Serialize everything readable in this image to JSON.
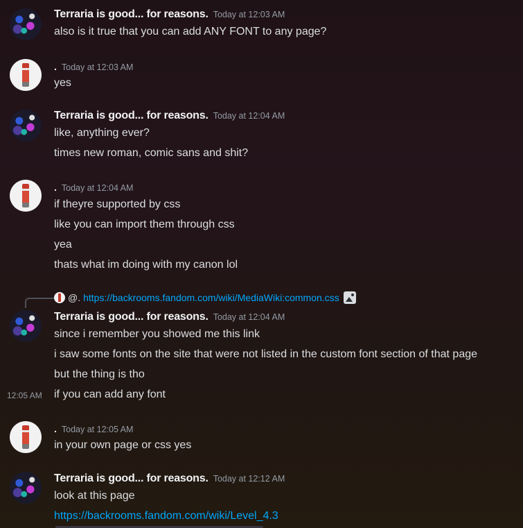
{
  "messages": [
    {
      "author": "Terraria is good... for reasons.",
      "time": "Today at 12:03 AM",
      "lines": [
        "also is it true that you can add ANY FONT to any page?"
      ]
    },
    {
      "author": ".",
      "time": "Today at 12:03 AM",
      "lines": [
        "yes"
      ]
    },
    {
      "author": "Terraria is good... for reasons.",
      "time": "Today at 12:04 AM",
      "lines": [
        "like, anything ever?",
        "times new roman, comic sans and shit?"
      ]
    },
    {
      "author": ".",
      "time": "Today at 12:04 AM",
      "lines": [
        "if theyre supported by css",
        "like you can import them through css",
        "yea",
        "thats what im doing with my canon lol"
      ]
    },
    {
      "reply": {
        "name": "@.",
        "link": "https://backrooms.fandom.com/wiki/MediaWiki:common.css"
      },
      "author": "Terraria is good... for reasons.",
      "time": "Today at 12:04 AM",
      "lines": [
        "since i remember you showed me this link",
        "i saw some fonts on the site that were not listed in the custom font section of that page",
        "but the thing is tho",
        "if you can add any font"
      ],
      "side_time": "12:05 AM"
    },
    {
      "author": ".",
      "time": "Today at 12:05 AM",
      "lines": [
        "in your own page or css yes"
      ]
    },
    {
      "author": "Terraria is good... for reasons.",
      "time": "Today at 12:12 AM",
      "lines": [
        "look at this page"
      ],
      "link_line": "https://backrooms.fandom.com/wiki/Level_4.3"
    }
  ],
  "colors": {
    "link": "#00a8fc",
    "timestamp": "#949ba4",
    "text": "#dbdee1"
  },
  "icons": {
    "attachment": "image-icon"
  }
}
